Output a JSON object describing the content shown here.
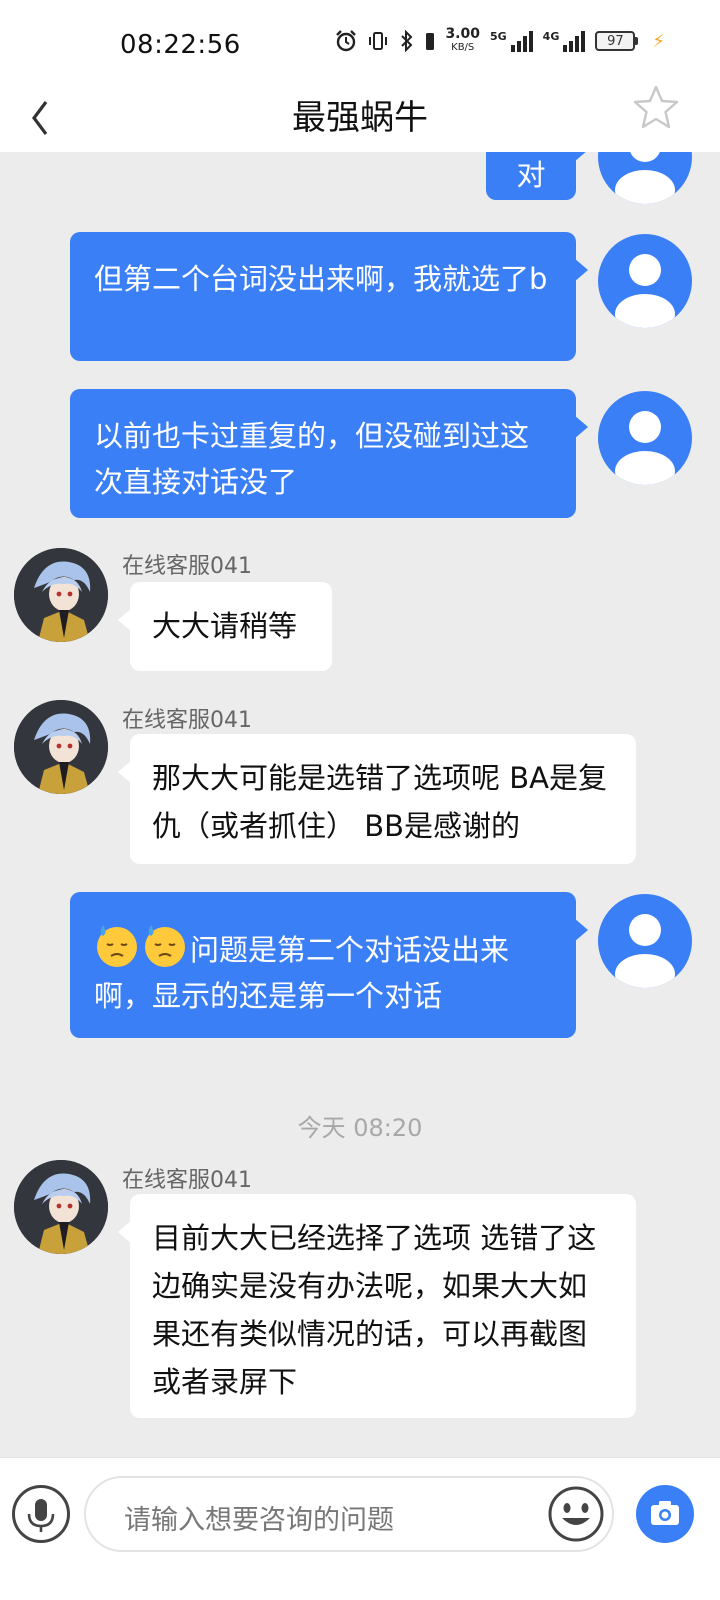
{
  "status_bar": {
    "time": "08:22:56",
    "net_speed_value": "3.00",
    "net_speed_unit": "KB/S",
    "sig1": "5G",
    "sig2": "4G",
    "battery": "97"
  },
  "header": {
    "title": "最强蜗牛",
    "back_icon": "chevron-left-icon",
    "favorite_icon": "star-outline-icon"
  },
  "messages": [
    {
      "from": "user",
      "text": "对"
    },
    {
      "from": "user",
      "text": "但第二个台词没出来啊，我就选了b"
    },
    {
      "from": "user",
      "text": "以前也卡过重复的，但没碰到过这次直接对话没了"
    },
    {
      "from": "agent",
      "sender": "在线客服041",
      "text": "大大请稍等"
    },
    {
      "from": "agent",
      "sender": "在线客服041",
      "text": "那大大可能是选错了选项呢 BA是复仇（或者抓住） BB是感谢的"
    },
    {
      "from": "user",
      "text": "问题是第二个对话没出来啊，显示的还是第一个对话",
      "emoji": "downcast-face-with-sweat"
    },
    {
      "from": "agent",
      "sender": "在线客服041",
      "text": "目前大大已经选择了选项 选错了这边确实是没有办法呢，如果大大如果还有类似情况的话，可以再截图或者录屏下"
    }
  ],
  "timestamp": "今天 08:20",
  "input_bar": {
    "placeholder": "请输入想要咨询的问题",
    "mic_icon": "microphone-icon",
    "emoji_icon": "smiley-icon",
    "camera_icon": "camera-icon"
  },
  "colors": {
    "accent": "#3b7ff7",
    "background": "#ececec"
  }
}
